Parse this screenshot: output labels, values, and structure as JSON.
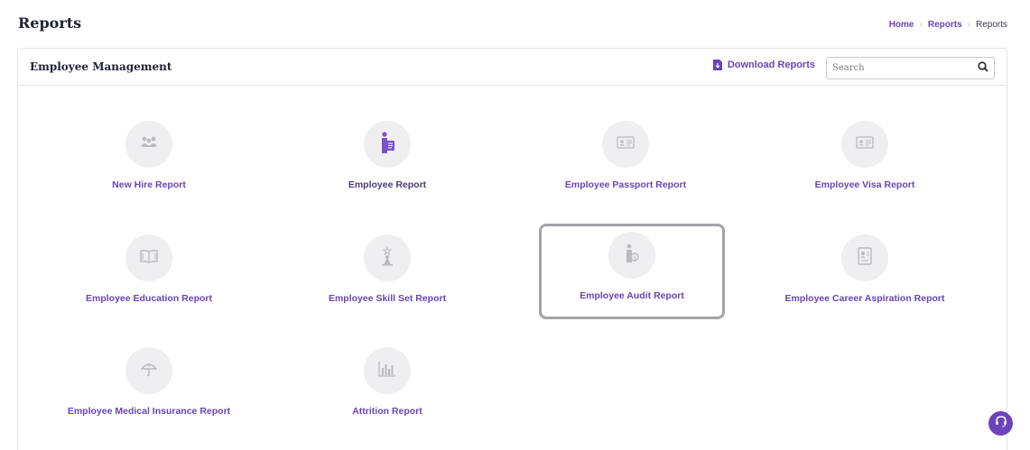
{
  "header": {
    "title": "Reports",
    "breadcrumb": [
      "Home",
      "Reports",
      "Reports"
    ]
  },
  "card": {
    "title": "Employee Management",
    "download_label": "Download Reports",
    "search_placeholder": "Search"
  },
  "tiles": [
    {
      "label": "New Hire Report",
      "icon": "people-group-icon"
    },
    {
      "label": "Employee Report",
      "icon": "person-document-icon"
    },
    {
      "label": "Employee Passport Report",
      "icon": "id-card-icon"
    },
    {
      "label": "Employee Visa Report",
      "icon": "id-card-icon"
    },
    {
      "label": "Employee Education Report",
      "icon": "open-book-icon"
    },
    {
      "label": "Employee Skill Set Report",
      "icon": "award-figure-icon"
    },
    {
      "label": "Employee Audit Report",
      "icon": "person-coin-icon",
      "selected": true
    },
    {
      "label": "Employee Career Aspiration Report",
      "icon": "profile-document-icon"
    },
    {
      "label": "Employee Medical Insurance Report",
      "icon": "umbrella-icon"
    },
    {
      "label": "Attrition Report",
      "icon": "bar-chart-icon"
    }
  ],
  "colors": {
    "accent": "#6a44b8",
    "icon_gray": "#b9b9c0",
    "circle_bg": "#efeff1"
  }
}
